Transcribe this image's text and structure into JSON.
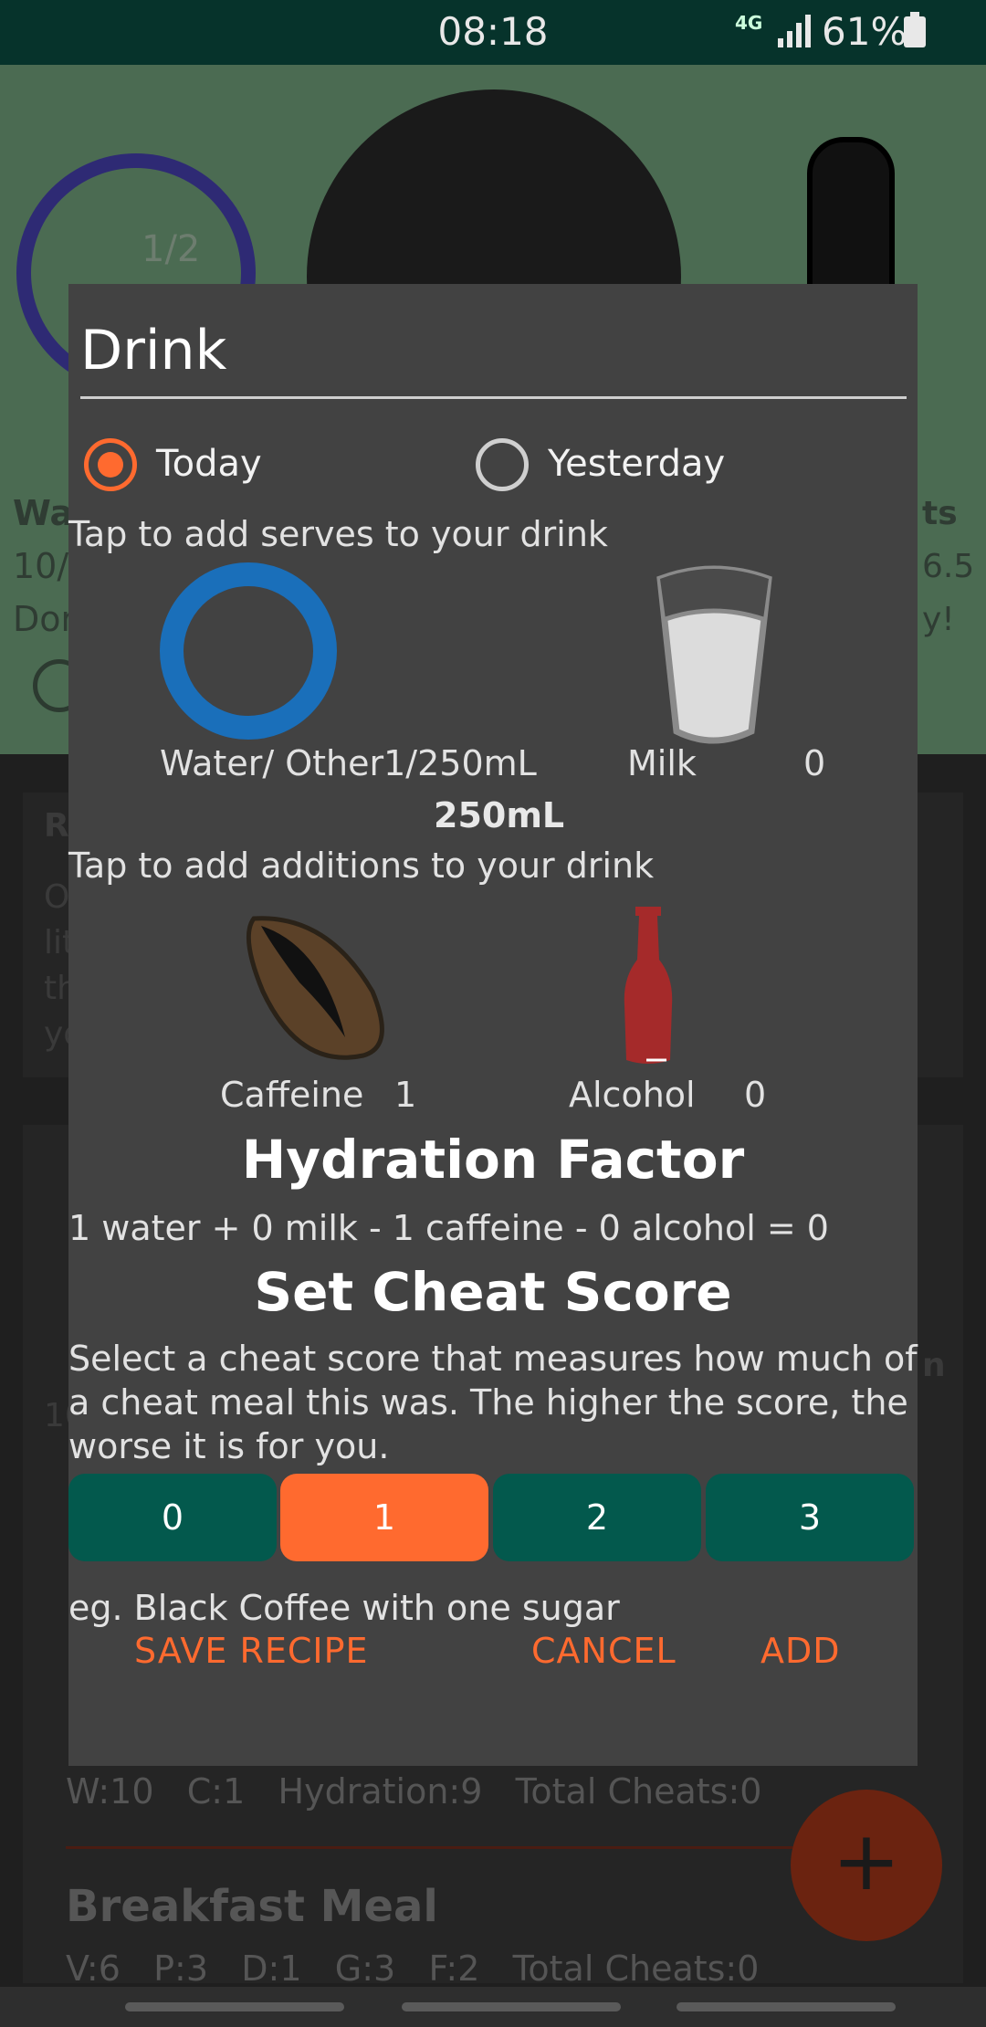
{
  "status_bar": {
    "time": "08:18",
    "network": "4G",
    "battery": "61%"
  },
  "background": {
    "ring_counter": "1/2",
    "left_lines": [
      "Wa",
      "10/",
      "Dor"
    ],
    "right_lines": [
      "ts",
      "6.5",
      "y!"
    ],
    "card_letters": [
      "R",
      "O",
      "lit",
      "th",
      "yo"
    ],
    "card2_left": "10",
    "card2_right": "n",
    "stats": {
      "w": "W:10",
      "c": "C:1",
      "hydration": "Hydration:9",
      "total_cheats": "Total Cheats:0"
    },
    "meal": {
      "title": "Breakfast Meal",
      "v": "V:6",
      "p": "P:3",
      "d": "D:1",
      "g": "G:3",
      "f": "F:2",
      "total_cheats": "Total Cheats:0"
    },
    "fab_icon": "plus-icon"
  },
  "dialog": {
    "title": "Drink",
    "day_options": {
      "today": "Today",
      "yesterday": "Yesterday",
      "selected": "today"
    },
    "serves_hint": "Tap to add serves to your drink",
    "water": {
      "label": "Water/ Other",
      "value": "1/250mL",
      "amount": "250mL"
    },
    "milk": {
      "label": "Milk",
      "count": "0"
    },
    "additions_hint": "Tap to add additions to your drink",
    "caffeine": {
      "label": "Caffeine",
      "count": "1"
    },
    "alcohol": {
      "label": "Alcohol",
      "count": "0"
    },
    "hydration": {
      "heading": "Hydration Factor",
      "formula": "1 water + 0 milk - 1 caffeine - 0 alcohol = 0"
    },
    "cheat": {
      "heading": "Set Cheat Score",
      "description": [
        "Select a cheat score that measures how much of",
        "a cheat meal this was. The higher the score, the",
        "worse it is for you."
      ],
      "options": [
        "0",
        "1",
        "2",
        "3"
      ],
      "selected": "1",
      "example": "eg. Black Coffee with one sugar"
    },
    "actions": {
      "save_recipe": "SAVE RECIPE",
      "cancel": "CANCEL",
      "add": "ADD"
    },
    "colors": {
      "accent": "#ff6a2f",
      "button": "#03594d",
      "water_ring": "#1a6fba"
    }
  }
}
